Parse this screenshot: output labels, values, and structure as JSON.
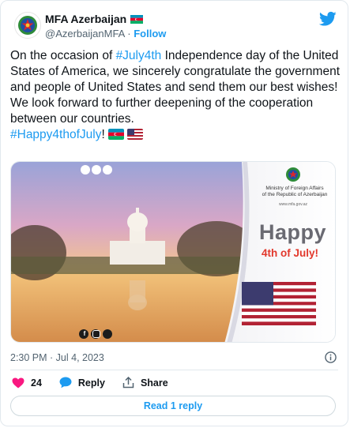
{
  "account": {
    "name": "MFA Azerbaijan",
    "handle": "@AzerbaijanMFA",
    "separator": "·",
    "follow_label": "Follow"
  },
  "tweet": {
    "line1_prefix": "On the occasion of ",
    "hashtag1": "#July4th",
    "line1_suffix": " Independence day of the United States of America, we sincerely congratulate the government and people of United States and send them our best wishes!",
    "line2": "We look forward to further deepening of the cooperation between our countries.",
    "hashtag2": "#Happy4thofJuly",
    "hashtag2_suffix": "!"
  },
  "media": {
    "ministry_line1": "Ministry of Foreign Affairs",
    "ministry_line2": "of the Republic of Azerbaijan",
    "website": "www.mfa.gov.az",
    "happy": "Happy",
    "july": "4th of July!"
  },
  "meta": {
    "timestamp": "2:30 PM · Jul 4, 2023"
  },
  "actions": {
    "likes": "24",
    "reply_label": "Reply",
    "share_label": "Share",
    "read_replies": "Read 1 reply"
  },
  "colors": {
    "accent": "#1d9bf0",
    "like": "#f91880",
    "text": "#0f1419",
    "muted": "#536471",
    "july_red": "#e2382c"
  },
  "icons": [
    "azerbaijan-emblem-icon",
    "azerbaijan-flag-icon",
    "twitter-bird-icon",
    "usa-flag-icon",
    "info-icon",
    "heart-icon",
    "reply-icon",
    "share-icon",
    "facebook-icon",
    "instagram-icon",
    "twitter-icon"
  ]
}
